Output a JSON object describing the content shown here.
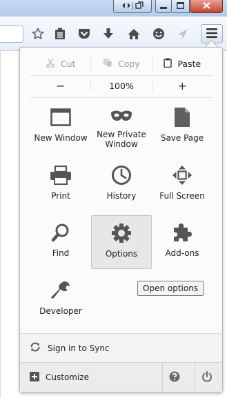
{
  "edit": {
    "cut_label": "Cut",
    "copy_label": "Copy",
    "paste_label": "Paste"
  },
  "zoom": {
    "decrease_label": "−",
    "level": "100%",
    "increase_label": "+"
  },
  "items": {
    "new_window": "New Window",
    "new_private_window": "New Private Window",
    "save_page": "Save Page",
    "print": "Print",
    "history": "History",
    "full_screen": "Full Screen",
    "find": "Find",
    "options": "Options",
    "addons": "Add-ons",
    "developer": "Developer"
  },
  "tooltip": "Open options",
  "sync_label": "Sign in to Sync",
  "customize_label": "Customize",
  "icons": [
    "back-forward-icon",
    "restore-icon",
    "minimize-icon",
    "maximize-icon",
    "close-icon",
    "bookmark-star-icon",
    "reading-list-icon",
    "pocket-icon",
    "download-icon",
    "home-icon",
    "social-icon",
    "share-icon",
    "hamburger-menu-icon",
    "scissors-icon",
    "copy-icon",
    "clipboard-icon",
    "window-icon",
    "mask-icon",
    "page-icon",
    "printer-icon",
    "clock-icon",
    "fullscreen-arrows-icon",
    "magnifier-icon",
    "gear-icon",
    "puzzle-icon",
    "wrench-icon",
    "sync-icon",
    "plus-box-icon",
    "help-icon",
    "power-icon"
  ]
}
